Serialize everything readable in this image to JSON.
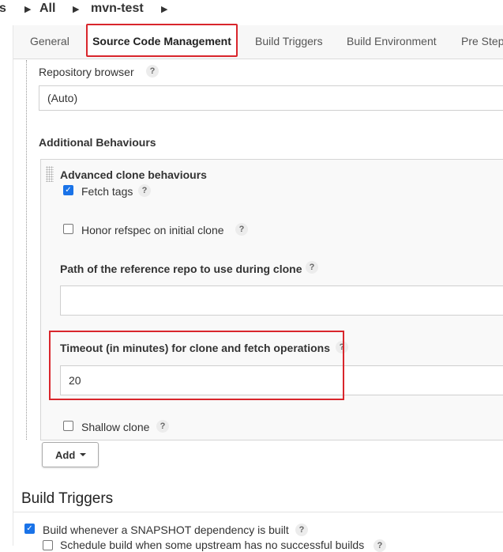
{
  "breadcrumb": {
    "partial": "s",
    "items": [
      "All",
      "mvn-test"
    ]
  },
  "tabs": {
    "items": [
      "General",
      "Source Code Management",
      "Build Triggers",
      "Build Environment",
      "Pre Steps"
    ],
    "active": "Source Code Management"
  },
  "scm": {
    "repo_browser_label": "Repository browser",
    "repo_browser_value": "(Auto)",
    "additional_behaviours_label": "Additional Behaviours",
    "clone_behaviour": {
      "title": "Advanced clone behaviours",
      "fetch_tags_label": "Fetch tags",
      "fetch_tags_checked": true,
      "honor_refspec_label": "Honor refspec on initial clone",
      "honor_refspec_checked": false,
      "reference_repo_label": "Path of the reference repo to use during clone",
      "reference_repo_value": "",
      "timeout_label": "Timeout (in minutes) for clone and fetch operations",
      "timeout_value": "20",
      "shallow_clone_label": "Shallow clone",
      "shallow_clone_checked": false
    },
    "add_button_label": "Add"
  },
  "build_triggers": {
    "title": "Build Triggers",
    "snapshot_label": "Build whenever a SNAPSHOT dependency is built",
    "snapshot_checked": true,
    "schedule_label": "Schedule build when some upstream has no successful builds",
    "schedule_checked": false
  },
  "help_glyph": "?",
  "colors": {
    "highlight": "#d9262c",
    "checkbox_accent": "#1a73e8"
  }
}
